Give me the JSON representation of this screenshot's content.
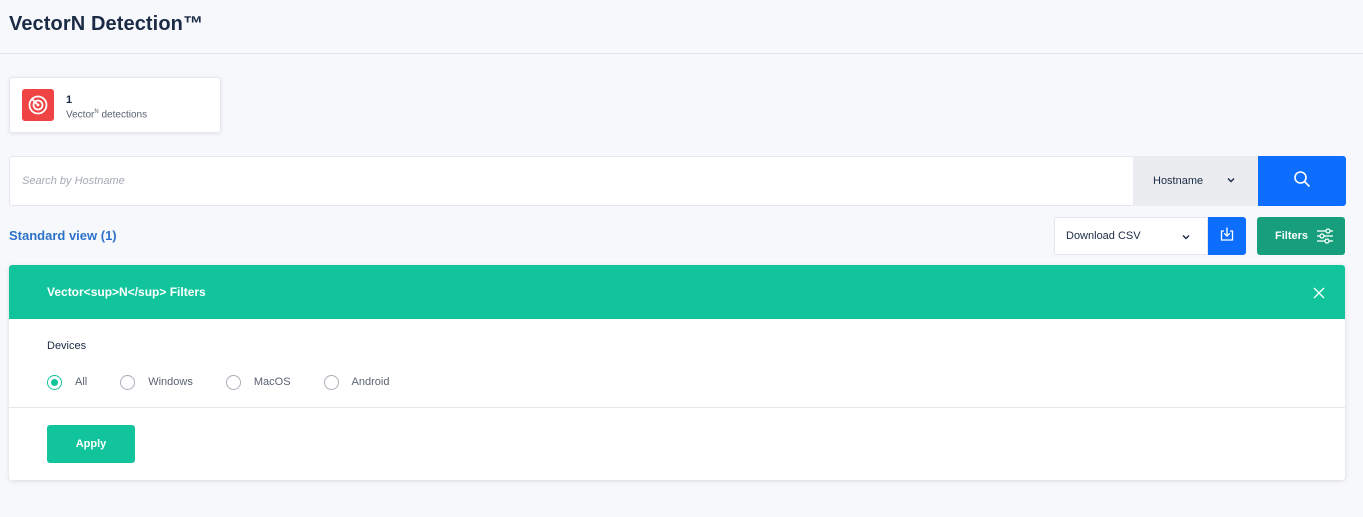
{
  "page": {
    "title": "VectorN Detection™"
  },
  "stats": {
    "count": "1",
    "label_prefix": "Vector",
    "label_sup": "N",
    "label_suffix": " detections",
    "icon": "radar-icon",
    "icon_color": "#f04444"
  },
  "search": {
    "placeholder": "Search by Hostname",
    "value": "",
    "field": "Hostname",
    "button_icon": "search-icon"
  },
  "toolbar": {
    "view_label": "Standard view (1)",
    "download_label": "Download CSV",
    "filters_label": "Filters"
  },
  "filters_panel": {
    "title": "Vector<sup>N</sup> Filters",
    "devices_label": "Devices",
    "options": [
      {
        "label": "All",
        "checked": true
      },
      {
        "label": "Windows",
        "checked": false
      },
      {
        "label": "MacOS",
        "checked": false
      },
      {
        "label": "Android",
        "checked": false
      }
    ],
    "apply_label": "Apply"
  },
  "colors": {
    "accent_blue": "#0d6efd",
    "accent_green": "#12c49c",
    "filters_green": "#179e7c",
    "title_navy": "#1b2b45",
    "link_blue": "#2d72c9"
  }
}
